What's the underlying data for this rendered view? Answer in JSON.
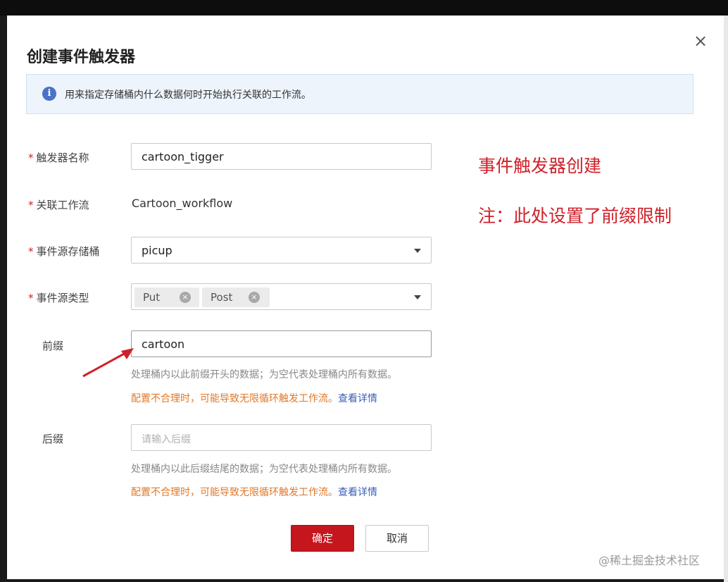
{
  "dialog": {
    "title": "创建事件触发器",
    "close_icon": "close-icon",
    "close_glyph": "×",
    "info": {
      "icon": "info-icon",
      "glyph": "i",
      "text": "用来指定存储桶内什么数据何时开始执行关联的工作流。"
    }
  },
  "form": {
    "required_mark": "*",
    "trigger_name": {
      "label": "触发器名称",
      "value": "cartoon_tigger"
    },
    "workflow": {
      "label": "关联工作流",
      "value": "Cartoon_workflow"
    },
    "bucket": {
      "label": "事件源存储桶",
      "value": "picup",
      "icon": "chevron-down-icon"
    },
    "event_type": {
      "label": "事件源类型",
      "tags": [
        {
          "label": "Put",
          "remove_icon": "tag-close-icon",
          "remove_glyph": "×"
        },
        {
          "label": "Post",
          "remove_icon": "tag-close-icon",
          "remove_glyph": "×"
        }
      ],
      "icon": "chevron-down-icon"
    },
    "prefix": {
      "label": "前缀",
      "value": "cartoon",
      "hint": "处理桶内以此前缀开头的数据；为空代表处理桶内所有数据。",
      "warning": "配置不合理时，可能导致无限循环触发工作流。",
      "link": "查看详情"
    },
    "suffix": {
      "label": "后缀",
      "placeholder": "请输入后缀",
      "hint": "处理桶内以此后缀结尾的数据；为空代表处理桶内所有数据。",
      "warning": "配置不合理时，可能导致无限循环触发工作流。",
      "link": "查看详情"
    }
  },
  "buttons": {
    "confirm": "确定",
    "cancel": "取消"
  },
  "annotations": {
    "line1": "事件触发器创建",
    "line2": "注：此处设置了前缀限制",
    "arrow_icon": "red-arrow-icon"
  },
  "watermark": "@稀土掘金技术社区",
  "colors": {
    "primary": "#c4161c",
    "annotation": "#d0202a",
    "warning": "#e07828",
    "link": "#3a5fb8",
    "info_bg": "#eef4fc"
  }
}
